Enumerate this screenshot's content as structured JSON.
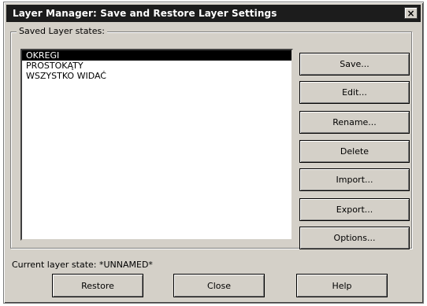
{
  "window": {
    "title": "Layer Manager: Save and Restore Layer Settings",
    "close_glyph": "×"
  },
  "group": {
    "label": "Saved Layer states:"
  },
  "list": {
    "items": [
      {
        "label": "OKREGI",
        "selected": true
      },
      {
        "label": "PROSTOKĄTY",
        "selected": false
      },
      {
        "label": "WSZYSTKO WIDAĆ",
        "selected": false
      }
    ]
  },
  "side_buttons": {
    "save": "Save...",
    "edit": "Edit...",
    "rename": "Rename...",
    "delete": "Delete",
    "import": "Import...",
    "export": "Export...",
    "options": "Options..."
  },
  "status": {
    "text": "Current layer state: *UNNAMED*"
  },
  "bottom_buttons": {
    "restore": "Restore",
    "close": "Close",
    "help": "Help"
  }
}
